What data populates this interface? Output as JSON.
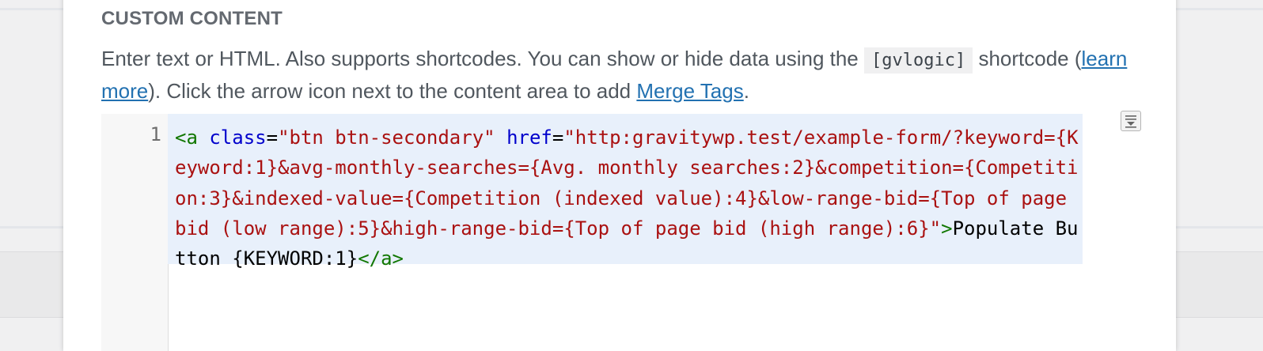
{
  "section": {
    "title": "CUSTOM CONTENT"
  },
  "description": {
    "part1": "Enter text or HTML. Also supports shortcodes. You can show or hide data using the ",
    "code": "[gvlogic]",
    "part2": " shortcode (",
    "learn_more_link": "learn more",
    "part3": "). Click the arrow icon next to the content area to add ",
    "merge_tags_link": "Merge Tags",
    "part4": "."
  },
  "editor": {
    "line_number": "1",
    "tokens": {
      "open_tag": "<a",
      "space1": " ",
      "attr_class": "class",
      "eq1": "=",
      "class_value": "\"btn btn-secondary\"",
      "space2": " ",
      "attr_href": "href",
      "eq2": "=",
      "href_value": "\"http:gravitywp.test/example-form/?keyword={Keyword:1}&avg-monthly-searches={Avg. monthly searches:2}&competition={Competition:3}&indexed-value={Competition (indexed value):4}&low-range-bid={Top of page bid (low range):5}&high-range-bid={Top of page bid (high range):6}\"",
      "tag_close": ">",
      "link_text": "Populate Button {KEYWORD:1}",
      "end_tag": "</a>"
    }
  },
  "icons": {
    "merge_tags": "merge-tags-dropdown-icon"
  }
}
